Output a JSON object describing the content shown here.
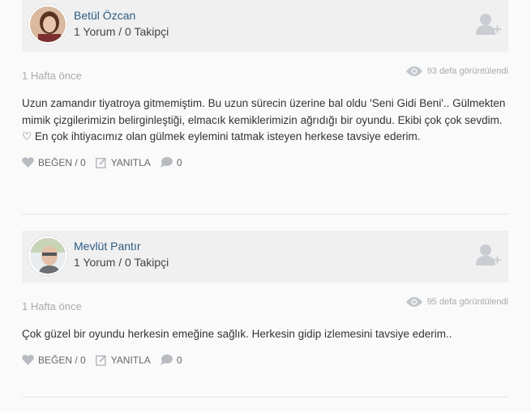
{
  "comments": [
    {
      "user": {
        "name": "Betül Özcan",
        "stats": "1 Yorum / 0 Takipçi"
      },
      "time": "1 Hafta önce",
      "views": "93 defa görüntülendi",
      "text": "Uzun zamandır tiyatroya gitmemiştim. Bu uzun sürecin üzerine bal oldu 'Seni Gidi Beni'.. Gülmekten mimik çizgilerimizin belirginleştiği, elmacık kemiklerimizin ağrıdığı bir oyundu. Ekibi çok çok sevdim. ♡ En çok ihtiyacımız olan gülmek eylemini tatmak isteyen herkese tavsiye ederim.",
      "like_label": "BEĞEN / 0",
      "reply_label": "YANITLA",
      "comment_count": "0"
    },
    {
      "user": {
        "name": "Mevlüt Pantır",
        "stats": "1 Yorum / 0 Takipçi"
      },
      "time": "1 Hafta önce",
      "views": "95 defa görüntülendi",
      "text": "Çok güzel bir oyundu herkesin emeğine sağlık. Herkesin gidip izlemesini tavsiye ederim..",
      "like_label": "BEĞEN / 0",
      "reply_label": "YANITLA",
      "comment_count": "0"
    }
  ]
}
